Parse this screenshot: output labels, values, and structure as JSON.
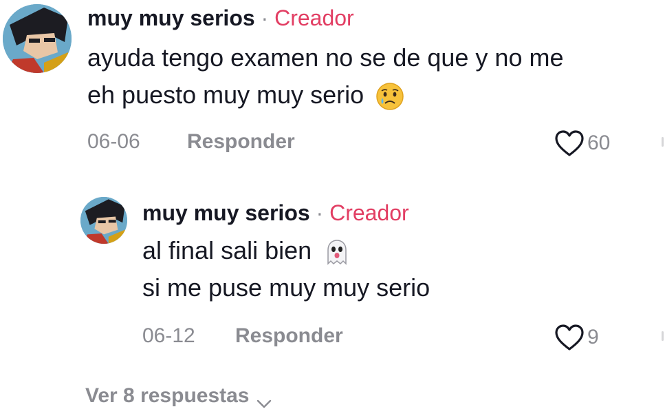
{
  "comments": [
    {
      "username": "muy muy serios",
      "separator": "·",
      "badge": "Creador",
      "text_lines": [
        "ayuda tengo examen no se de que y no me",
        "eh puesto muy muy serio"
      ],
      "emoji": "crying-face",
      "date": "06-06",
      "reply_label": "Responder",
      "likes": "60"
    },
    {
      "username": "muy muy serios",
      "separator": "·",
      "badge": "Creador",
      "text_lines": [
        "al final sali bien",
        "si me puse muy muy serio"
      ],
      "emoji": "ghost",
      "date": "06-12",
      "reply_label": "Responder",
      "likes": "9"
    }
  ],
  "view_replies_label": "Ver 8 respuestas",
  "colors": {
    "creator_badge": "#e23e63",
    "secondary_text": "#8a8b91",
    "primary_text": "#161823"
  }
}
